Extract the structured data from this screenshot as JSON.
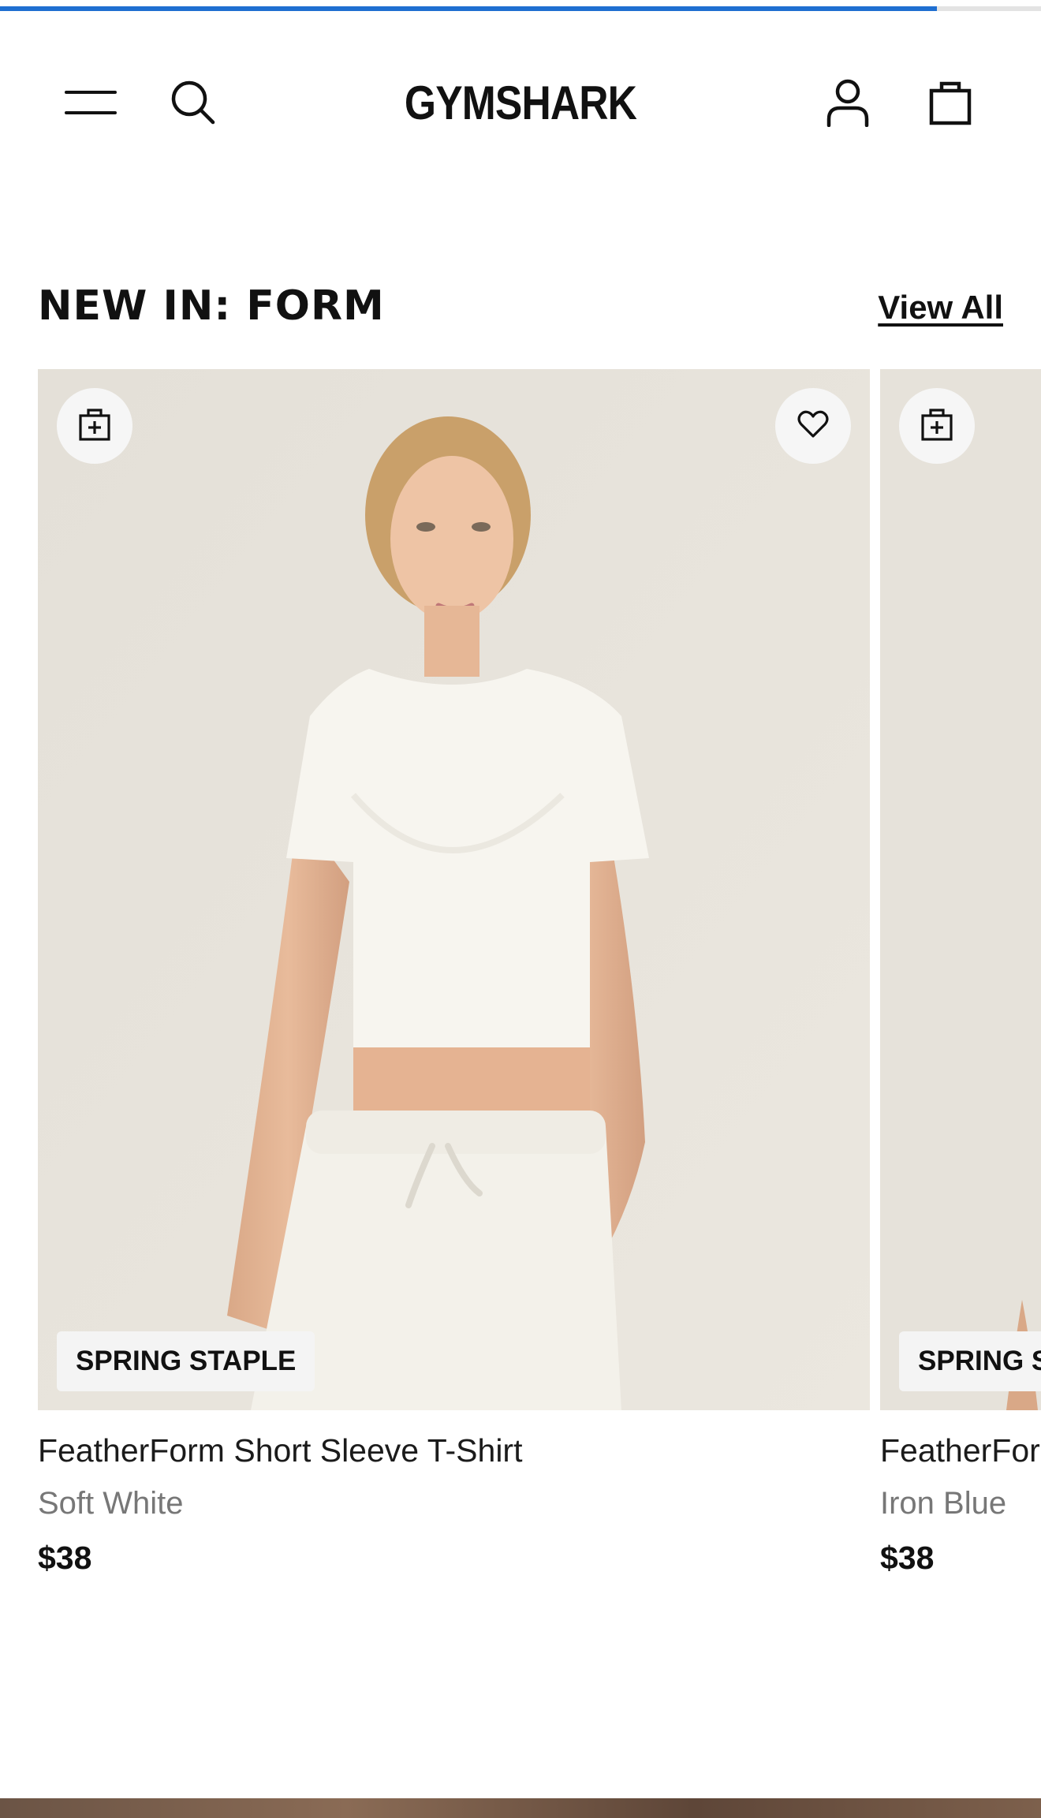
{
  "progress": {
    "percent": 90,
    "fill_color": "#1f6fd1"
  },
  "header": {
    "menu_icon": "hamburger-menu-icon",
    "search_icon": "search-icon",
    "logo_text": "GYMSHARK",
    "account_icon": "account-icon",
    "bag_icon": "shopping-bag-icon"
  },
  "section": {
    "title": "NEW IN: FORM",
    "view_all": "View All"
  },
  "products": [
    {
      "badge": "SPRING STAPLE",
      "name": "FeatherForm Short Sleeve T-Shirt",
      "color": "Soft White",
      "price": "$38",
      "quick_add_icon": "bag-plus-icon",
      "wishlist_icon": "heart-icon"
    },
    {
      "badge": "SPRING S",
      "name": "FeatherFor",
      "color": "Iron Blue",
      "price": "$38",
      "quick_add_icon": "bag-plus-icon"
    }
  ]
}
